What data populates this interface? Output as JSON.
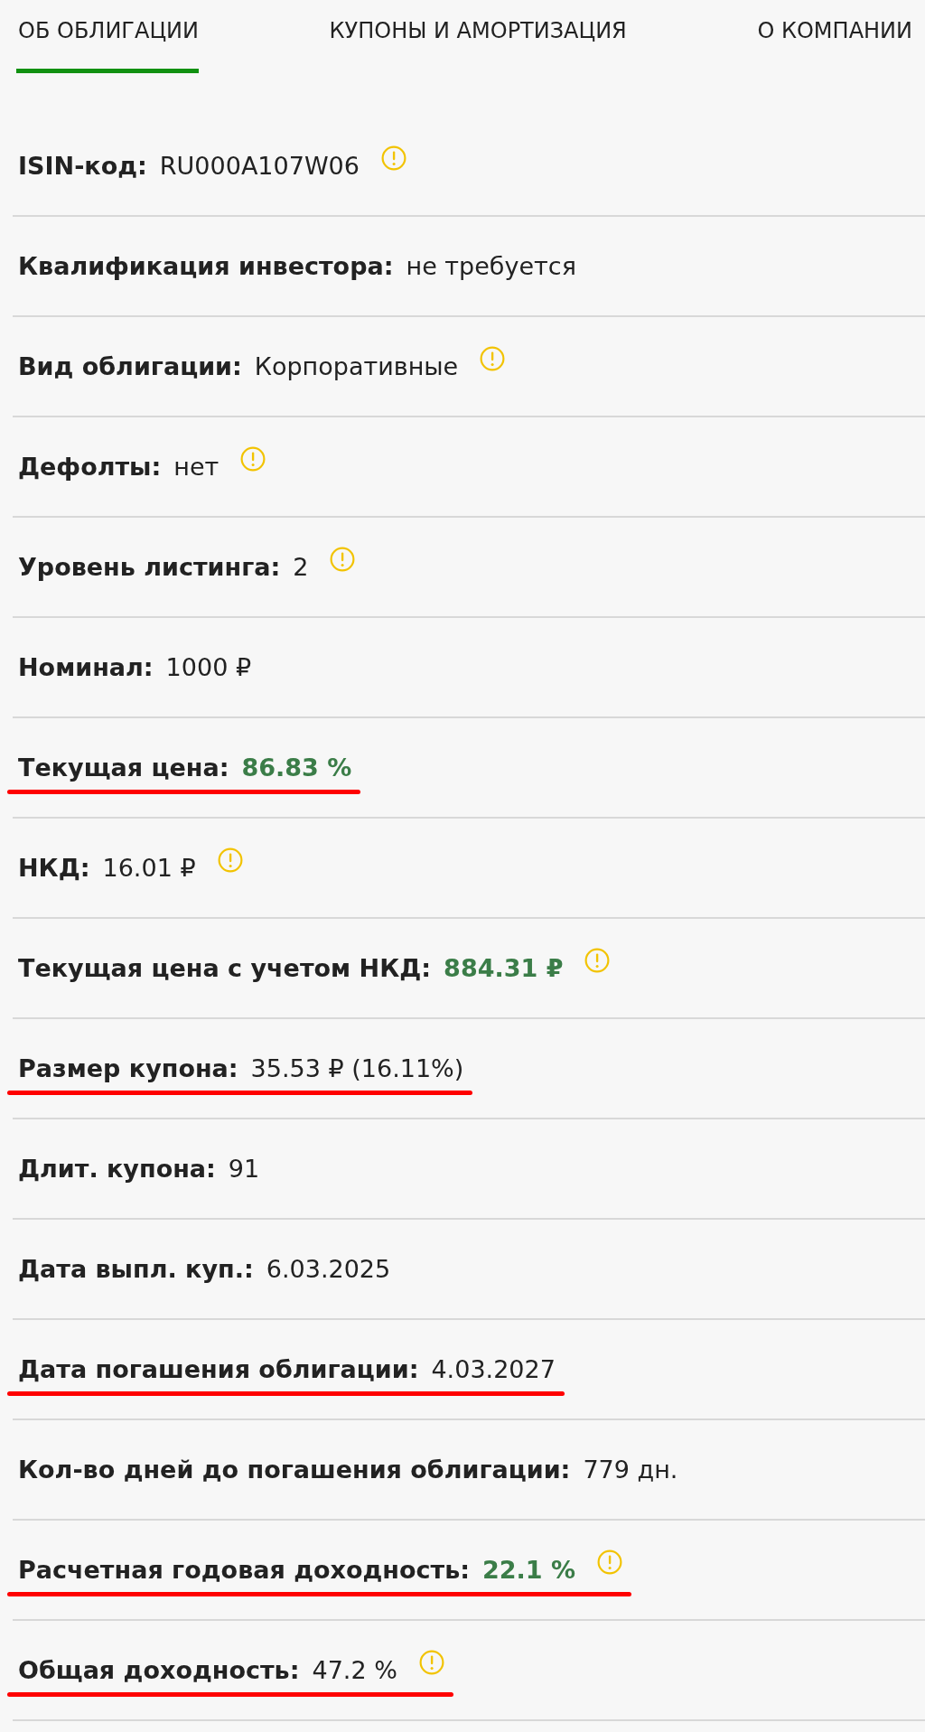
{
  "tabs": [
    {
      "label": "ОБ ОБЛИГАЦИИ",
      "selected": true
    },
    {
      "label": "КУПОНЫ И АМОРТИЗАЦИЯ",
      "selected": false
    },
    {
      "label": "О КОМПАНИИ",
      "selected": false
    }
  ],
  "rows": [
    {
      "label": "ISIN-код:",
      "value": "RU000A107W06",
      "kind": "plain",
      "info": true,
      "marked": false
    },
    {
      "label": "Квалификация инвестора:",
      "value": "не требуется",
      "kind": "plain",
      "info": false,
      "marked": false
    },
    {
      "label": "Вид облигации:",
      "value": "Корпоративные",
      "kind": "plain",
      "info": true,
      "marked": false
    },
    {
      "label": "Дефолты:",
      "value": "нет",
      "kind": "plain",
      "info": true,
      "marked": false
    },
    {
      "label": "Уровень листинга:",
      "value": "2",
      "kind": "plain",
      "info": true,
      "marked": false
    },
    {
      "label": "Номинал:",
      "value": "1000 ₽",
      "kind": "plain",
      "info": false,
      "marked": false
    },
    {
      "label": "Текущая цена:",
      "value": "86.83 %",
      "kind": "accent",
      "info": false,
      "marked": true
    },
    {
      "label": "НКД:",
      "value": "16.01 ₽",
      "kind": "plain",
      "info": true,
      "marked": false
    },
    {
      "label": "Текущая цена с учетом НКД:",
      "value": "884.31 ₽",
      "kind": "accent",
      "info": true,
      "marked": false
    },
    {
      "label": "Размер купона:",
      "value": "35.53 ₽ (16.11%)",
      "kind": "plain",
      "info": false,
      "marked": true
    },
    {
      "label": "Длит. купона:",
      "value": "91",
      "kind": "plain",
      "info": false,
      "marked": false
    },
    {
      "label": "Дата выпл. куп.:",
      "value": "6.03.2025",
      "kind": "plain",
      "info": false,
      "marked": false
    },
    {
      "label": "Дата погашения облигации:",
      "value": "4.03.2027",
      "kind": "plain",
      "info": false,
      "marked": true
    },
    {
      "label": "Кол-во дней до погашения облигации:",
      "value": "779 дн.",
      "kind": "plain",
      "info": false,
      "marked": false
    },
    {
      "label": "Расчетная годовая доходность:",
      "value": "22.1 %",
      "kind": "accent",
      "info": true,
      "marked": true
    },
    {
      "label": "Общая доходность:",
      "value": "47.2 %",
      "kind": "plain",
      "info": true,
      "marked": true
    }
  ]
}
